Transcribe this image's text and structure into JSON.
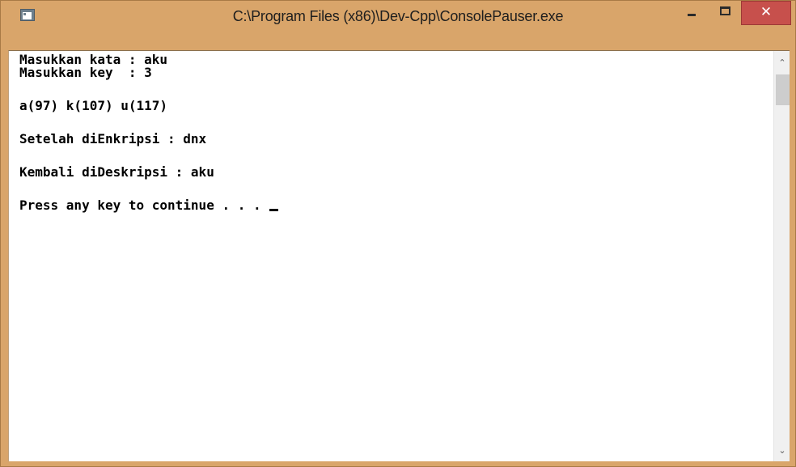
{
  "window": {
    "title": "C:\\Program Files (x86)\\Dev-Cpp\\ConsolePauser.exe",
    "icon": "console-app-icon",
    "controls": {
      "minimize_icon": "minimize-icon",
      "maximize_icon": "maximize-icon",
      "close_label": "✕"
    },
    "accent_color": "#d9a56a",
    "close_color": "#c7504c"
  },
  "console": {
    "lines": [
      "Masukkan kata : aku",
      "Masukkan key  : 3",
      "a(97) k(107) u(117)",
      "Setelah diEnkripsi : dnx",
      "Kembali diDeskripsi : aku",
      "Press any key to continue . . . "
    ]
  },
  "scrollbar": {
    "up_arrow": "⌃",
    "down_arrow": "⌄"
  }
}
